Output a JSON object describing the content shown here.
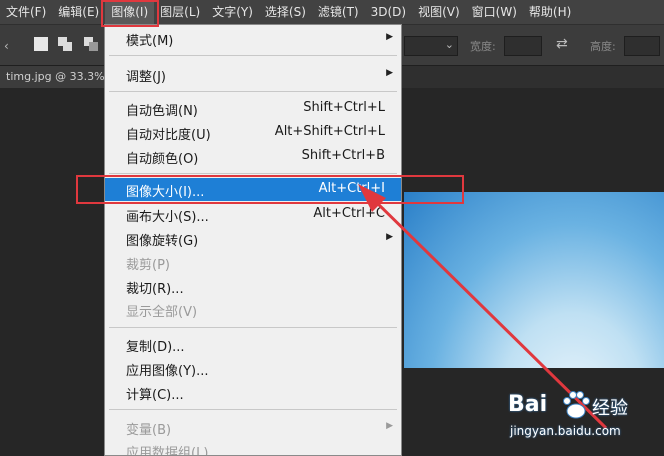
{
  "menubar": {
    "items": [
      "文件(F)",
      "编辑(E)",
      "图像(I)",
      "图层(L)",
      "文字(Y)",
      "选择(S)",
      "滤镜(T)",
      "3D(D)",
      "视图(V)",
      "窗口(W)",
      "帮助(H)"
    ]
  },
  "options": {
    "width_label": "宽度:",
    "height_label": "高度:"
  },
  "document_tab": "timg.jpg @ 33.3%",
  "image_menu": {
    "items": [
      {
        "label": "模式(M)",
        "shortcut": "",
        "submenu": true,
        "enabled": true
      },
      {
        "label": "调整(J)",
        "shortcut": "",
        "submenu": true,
        "enabled": true
      },
      {
        "label": "自动色调(N)",
        "shortcut": "Shift+Ctrl+L",
        "submenu": false,
        "enabled": true
      },
      {
        "label": "自动对比度(U)",
        "shortcut": "Alt+Shift+Ctrl+L",
        "submenu": false,
        "enabled": true
      },
      {
        "label": "自动颜色(O)",
        "shortcut": "Shift+Ctrl+B",
        "submenu": false,
        "enabled": true
      },
      {
        "label": "图像大小(I)...",
        "shortcut": "Alt+Ctrl+I",
        "submenu": false,
        "enabled": true,
        "highlighted": true
      },
      {
        "label": "画布大小(S)...",
        "shortcut": "Alt+Ctrl+C",
        "submenu": false,
        "enabled": true
      },
      {
        "label": "图像旋转(G)",
        "shortcut": "",
        "submenu": true,
        "enabled": true
      },
      {
        "label": "裁剪(P)",
        "shortcut": "",
        "submenu": false,
        "enabled": false
      },
      {
        "label": "裁切(R)...",
        "shortcut": "",
        "submenu": false,
        "enabled": true
      },
      {
        "label": "显示全部(V)",
        "shortcut": "",
        "submenu": false,
        "enabled": false
      },
      {
        "label": "复制(D)...",
        "shortcut": "",
        "submenu": false,
        "enabled": true
      },
      {
        "label": "应用图像(Y)...",
        "shortcut": "",
        "submenu": false,
        "enabled": true
      },
      {
        "label": "计算(C)...",
        "shortcut": "",
        "submenu": false,
        "enabled": true
      },
      {
        "label": "变量(B)",
        "shortcut": "",
        "submenu": true,
        "enabled": false
      },
      {
        "label": "应用数据组(L)...",
        "shortcut": "",
        "submenu": false,
        "enabled": false
      }
    ]
  },
  "watermark": {
    "logo": "Bai",
    "logo_suffix": "经验",
    "url": "jingyan.baidu.com"
  },
  "colors": {
    "highlight": "#1e7fd6",
    "annotation": "#e0383e"
  }
}
